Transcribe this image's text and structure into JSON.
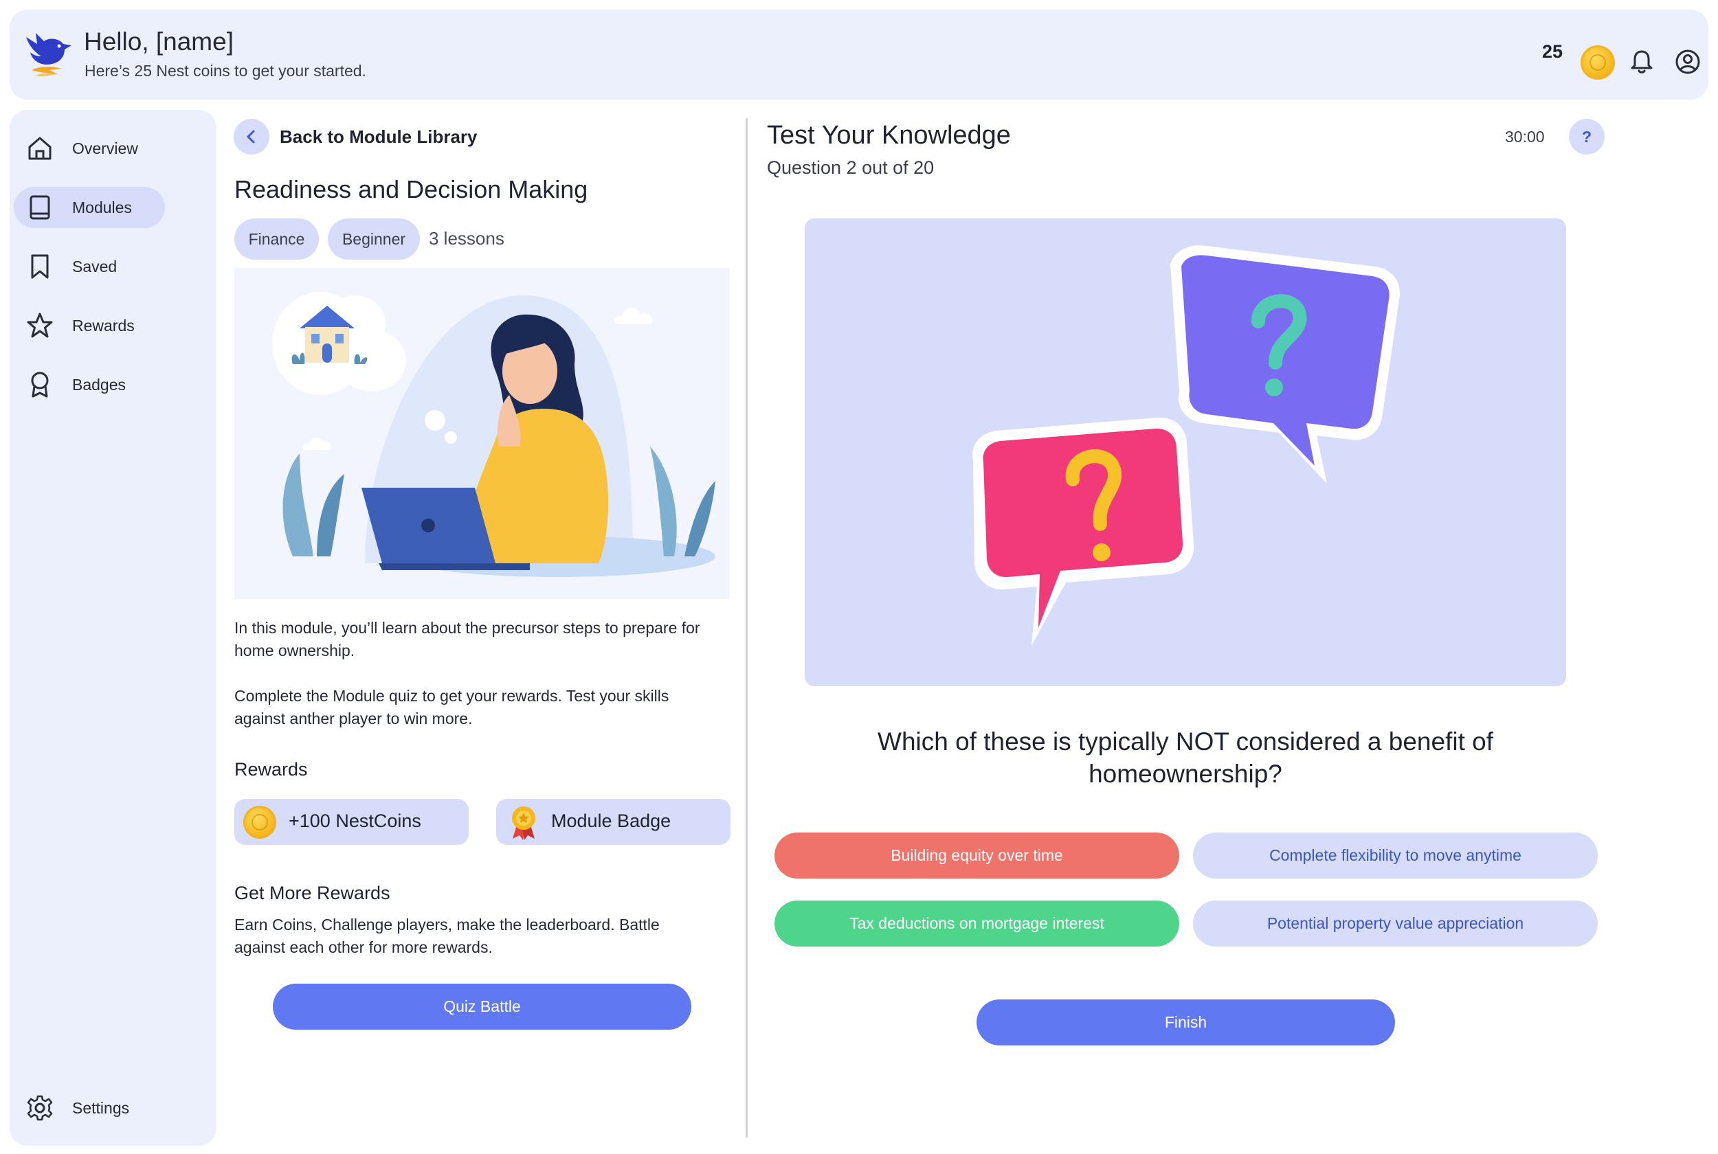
{
  "header": {
    "title": "Hello, [name]",
    "subtitle": "Here’s 25 Nest coins to get your started.",
    "coin_count": "25",
    "icons": [
      "bird-logo-icon",
      "coin-icon",
      "bell-icon",
      "user-account-icon"
    ]
  },
  "sidebar": {
    "items": [
      {
        "label": "Overview",
        "icon": "home-icon",
        "active": false
      },
      {
        "label": "Modules",
        "icon": "book-icon",
        "active": true
      },
      {
        "label": "Saved",
        "icon": "bookmark-icon",
        "active": false
      },
      {
        "label": "Rewards",
        "icon": "star-icon",
        "active": false
      },
      {
        "label": "Badges",
        "icon": "badge-icon",
        "active": false
      }
    ],
    "settings_label": "Settings"
  },
  "module": {
    "back_label": "Back to Module Library",
    "title": "Readiness and Decision Making",
    "tags": [
      "Finance",
      "Beginner"
    ],
    "lessons": "3 lessons",
    "description_1": "In this module, you’ll learn about the precursor steps to prepare for home ownership.",
    "description_2": "Complete the Module quiz to get your rewards. Test your skills against anther player to win more.",
    "rewards_heading": "Rewards",
    "rewards": [
      "+100 NestCoins",
      "Module Badge"
    ],
    "more_heading": "Get More Rewards",
    "more_text": "Earn Coins,  Challenge players, make the leaderboard. Battle against each other for more rewards.",
    "quiz_battle_label": "Quiz Battle"
  },
  "quiz": {
    "title": "Test Your Knowledge",
    "progress": "Question 2 out of 20",
    "timer": "30:00",
    "help_label": "?",
    "question": "Which of these is typically NOT considered a benefit of homeownership?",
    "answers": [
      {
        "label": "Building equity over time",
        "state": "wrong"
      },
      {
        "label": "Complete flexibility to move anytime",
        "state": "neutral"
      },
      {
        "label": "Tax deductions on mortgage interest",
        "state": "correct"
      },
      {
        "label": "Potential property value appreciation",
        "state": "neutral"
      }
    ],
    "finish_label": "Finish"
  },
  "colors": {
    "accent": "#6079f2",
    "panel_bg": "#eceffc",
    "pill_bg": "#d6dcfa",
    "wrong": "#f0736b",
    "correct": "#4fd48b"
  }
}
